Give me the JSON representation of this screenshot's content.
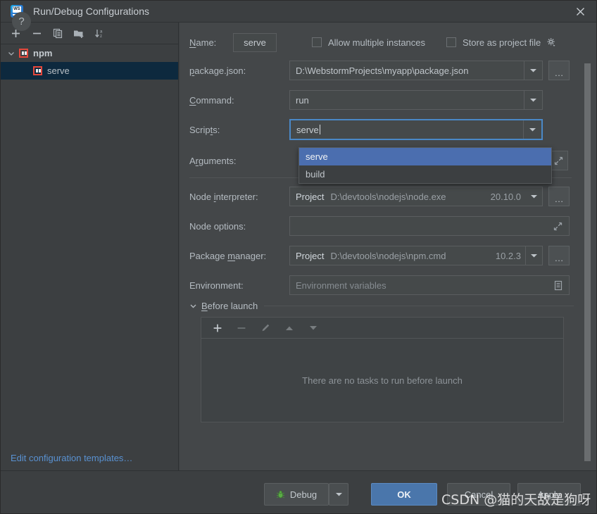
{
  "window": {
    "title": "Run/Debug Configurations",
    "app_icon": "webstorm-icon",
    "close_icon": "close-icon"
  },
  "sidebar": {
    "toolbar": [
      {
        "name": "add-configuration-button",
        "icon": "plus-icon",
        "label": "+"
      },
      {
        "name": "remove-configuration-button",
        "icon": "minus-icon",
        "label": "−"
      },
      {
        "name": "copy-configuration-button",
        "icon": "copy-icon",
        "label": ""
      },
      {
        "name": "save-configuration-button",
        "icon": "folder-add-icon",
        "label": ""
      },
      {
        "name": "sort-configurations-button",
        "icon": "sort-alphabetically-icon",
        "label": ""
      }
    ],
    "tree": [
      {
        "label": "npm",
        "type": "group",
        "selected": false,
        "icon": "npm-icon"
      },
      {
        "label": "serve",
        "type": "child",
        "selected": true,
        "icon": "npm-icon"
      }
    ],
    "edit_templates_link": "Edit configuration templates…"
  },
  "form": {
    "name_label": "Name:",
    "name_label_mnemonic": "N",
    "name_value": "serve",
    "allow_multiple_instances": {
      "label": "Allow multiple instances",
      "checked": false
    },
    "store_as_project_file": {
      "label": "Store as project file",
      "checked": false,
      "gear_icon": "gear-icon"
    },
    "package_json_label": "package.json:",
    "package_json_label_mnemonic": "p",
    "package_json_value": "D:\\WebstormProjects\\myapp\\package.json",
    "command_label": "Command:",
    "command_label_mnemonic": "C",
    "command_value": "run",
    "scripts_label": "Scripts:",
    "scripts_label_mnemonic": "t",
    "scripts_value": "serve",
    "scripts_dropdown_options": [
      "serve",
      "build"
    ],
    "scripts_dropdown_selected": "serve",
    "arguments_label": "Arguments:",
    "arguments_label_mnemonic": "r",
    "arguments_value": "",
    "node_interpreter_label": "Node interpreter:",
    "node_interpreter_label_mnemonic": "i",
    "node_interpreter_scope": "Project",
    "node_interpreter_path": "D:\\devtools\\nodejs\\node.exe",
    "node_interpreter_version": "20.10.0",
    "node_options_label": "Node options:",
    "node_options_value": "",
    "package_manager_label": "Package manager:",
    "package_manager_label_mnemonic": "m",
    "package_manager_scope": "Project",
    "package_manager_path": "D:\\devtools\\nodejs\\npm.cmd",
    "package_manager_version": "10.2.3",
    "environment_label": "Environment:",
    "environment_placeholder": "Environment variables",
    "environment_value": "",
    "ellipsis_label": "…"
  },
  "before_launch": {
    "title": "Before launch",
    "title_mnemonic": "B",
    "expanded": true,
    "toolbar": [
      {
        "name": "add-task-button",
        "icon": "plus-icon",
        "enabled": true
      },
      {
        "name": "remove-task-button",
        "icon": "minus-icon",
        "enabled": false
      },
      {
        "name": "edit-task-button",
        "icon": "pencil-icon",
        "enabled": false
      },
      {
        "name": "move-task-up-button",
        "icon": "arrow-up-icon",
        "enabled": false
      },
      {
        "name": "move-task-down-button",
        "icon": "arrow-down-icon",
        "enabled": false
      }
    ],
    "empty_text": "There are no tasks to run before launch"
  },
  "footer": {
    "help_label": "?",
    "debug_label": "Debug",
    "debug_icon": "bug-icon",
    "ok_label": "OK",
    "cancel_label": "Cancel",
    "apply_label": "Apply"
  },
  "watermark": "CSDN @猫的天敌是狗呀",
  "colors": {
    "accent_blue": "#4a76ab",
    "selection_blue": "#4b6eaf",
    "focus_border": "#4a88c7",
    "link_blue": "#5991d1",
    "npm_red": "#e4483c",
    "bug_green": "#5aab46",
    "panel_bg": "#3c3f41",
    "form_bg": "#444749"
  }
}
